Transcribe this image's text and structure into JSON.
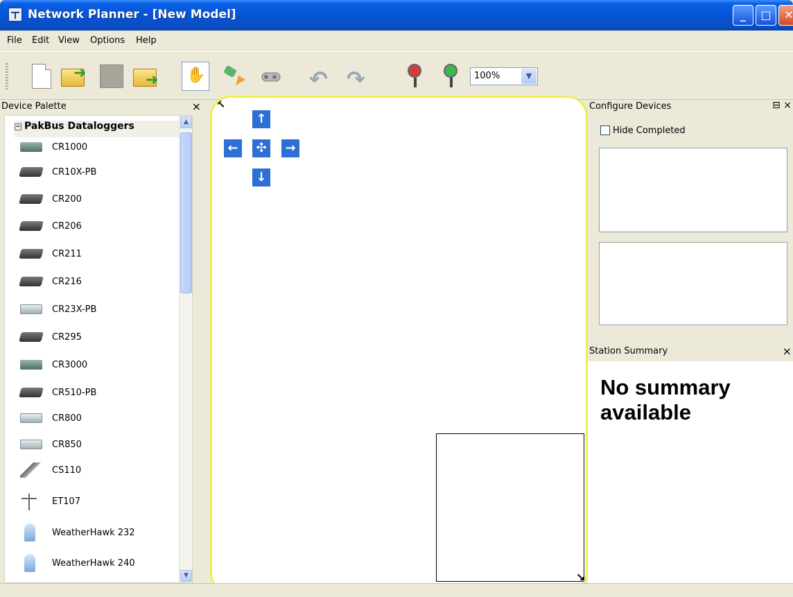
{
  "window": {
    "title": "Network Planner - [New Model]",
    "min_icon": "minimize-icon",
    "max_icon": "maximize-icon",
    "close_icon": "close-icon"
  },
  "menu": [
    "File",
    "Edit",
    "View",
    "Options",
    "Help"
  ],
  "toolbar": {
    "zoom_value": "100%",
    "buttons": [
      "new-document-icon",
      "open-folder-icon",
      "save-icon",
      "export-icon",
      "pan-hand-icon",
      "add-link-icon",
      "connect-icon",
      "undo-icon",
      "redo-icon",
      "zoom-out-icon",
      "zoom-in-icon"
    ]
  },
  "palette": {
    "title": "Device Palette",
    "close_label": "×",
    "group": "PakBus Dataloggers",
    "items": [
      {
        "label": "CR1000",
        "icon": "dl2"
      },
      {
        "label": "CR10X-PB",
        "icon": "dl"
      },
      {
        "label": "CR200",
        "icon": "dl"
      },
      {
        "label": "CR206",
        "icon": "dl"
      },
      {
        "label": "CR211",
        "icon": "dl"
      },
      {
        "label": "CR216",
        "icon": "dl"
      },
      {
        "label": "CR23X-PB",
        "icon": "silver"
      },
      {
        "label": "CR295",
        "icon": "dl"
      },
      {
        "label": "CR3000",
        "icon": "dl2"
      },
      {
        "label": "CR510-PB",
        "icon": "dl"
      },
      {
        "label": "CR800",
        "icon": "silver"
      },
      {
        "label": "CR850",
        "icon": "silver"
      },
      {
        "label": "CS110",
        "icon": "stick"
      },
      {
        "label": "ET107",
        "icon": "tower"
      },
      {
        "label": "WeatherHawk 232",
        "icon": "hawk"
      },
      {
        "label": "WeatherHawk 240",
        "icon": "hawk"
      }
    ]
  },
  "canvas": {
    "nav": {
      "up": "↑",
      "down": "↓",
      "left": "←",
      "right": "→",
      "center": "✣"
    }
  },
  "config": {
    "title": "Configure Devices",
    "controls": "⊟ ×",
    "hide_completed": "Hide Completed"
  },
  "summary": {
    "title": "Station Summary",
    "close_label": "×",
    "text": "No summary available"
  }
}
